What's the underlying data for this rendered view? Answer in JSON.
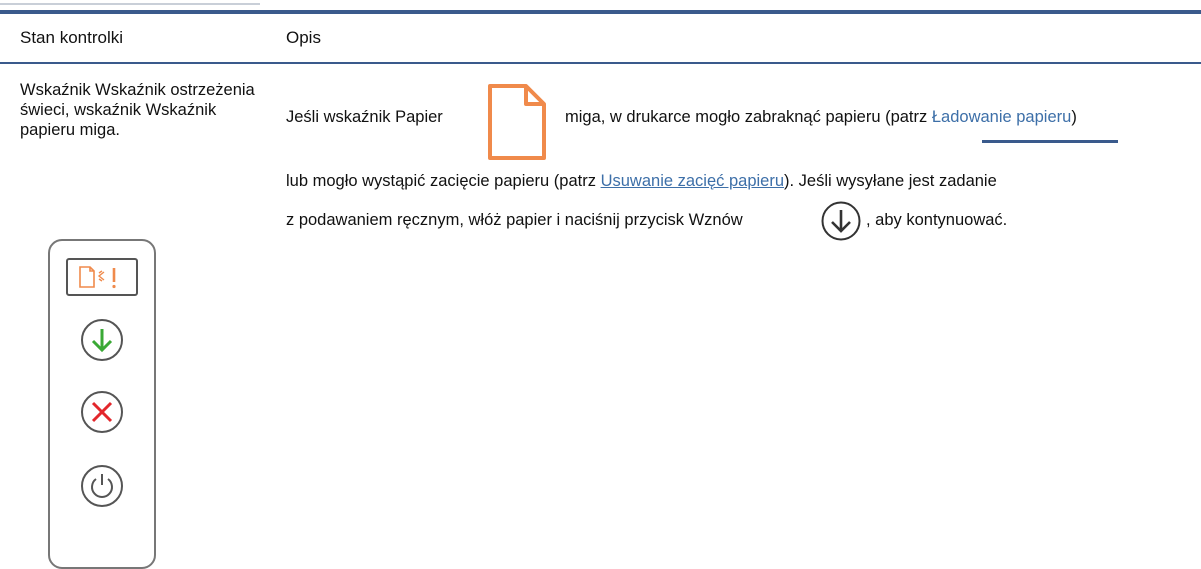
{
  "table": {
    "header": {
      "col_state": "Stan kontrolki",
      "col_desc": "Opis"
    },
    "row": {
      "state_text": "Wskaźnik Wskaźnik ostrzeżenia świeci, wskaźnik Wskaźnik papieru miga.",
      "description": {
        "line1_a": "Jeśli wskaźnik Papier",
        "line1_b": "miga, w drukarce mogło zabraknąć papieru (patrz",
        "line1_link": "Ładowanie papieru",
        "line1_c": ")",
        "line2_a": "lub mogło wystąpić zacięcie papieru (patrz",
        "line2_link": "Usuwanie zacięć papieru",
        "line2_b": "). Jeśli wysyłane jest zadanie",
        "line3_a": "z podawaniem ręcznym, włóż papier i naciśnij przycisk Wznów",
        "line3_b": ", aby kontynuować."
      }
    }
  },
  "icons": {
    "paper_icon": "paper-icon",
    "resume_icon": "resume-arrow-icon",
    "panel_buttons": [
      "resume-button-icon",
      "cancel-button-icon",
      "power-button-icon"
    ],
    "attention_icon": "attention-exclamation-icon"
  },
  "colors": {
    "accent_rule": "#3a5a8c",
    "link": "#3d6fa8",
    "paper_orange": "#f08a4b",
    "resume_green": "#3aa935",
    "cancel_red": "#e3262b"
  }
}
